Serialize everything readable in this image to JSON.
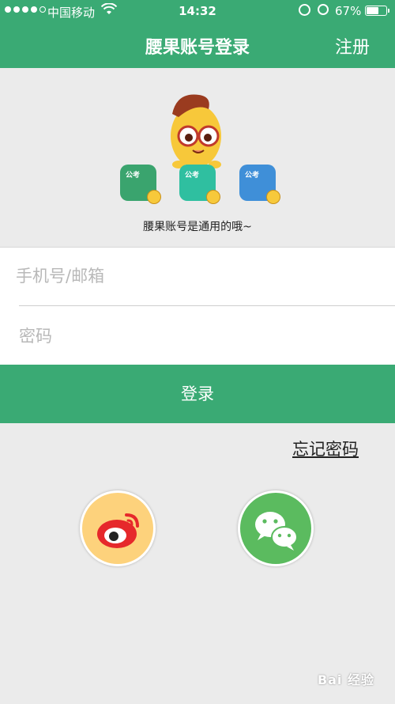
{
  "status_bar": {
    "carrier": "中国移动",
    "time": "14:32",
    "battery_percent": "67%",
    "battery_level": 0.67
  },
  "nav": {
    "title": "腰果账号登录",
    "register_label": "注册"
  },
  "illustration": {
    "icon_tag": "公考",
    "tagline": "腰果账号是通用的哦~"
  },
  "form": {
    "account_placeholder": "手机号/邮箱",
    "password_placeholder": "密码",
    "login_label": "登录",
    "forgot_label": "忘记密码"
  },
  "social": [
    {
      "name": "weibo-icon"
    },
    {
      "name": "wechat-icon"
    }
  ],
  "watermark": "Bai 经验",
  "colors": {
    "brand_green": "#3aaa74",
    "weibo_yellow": "#fdd27c",
    "wechat_green": "#5bbb5f"
  }
}
